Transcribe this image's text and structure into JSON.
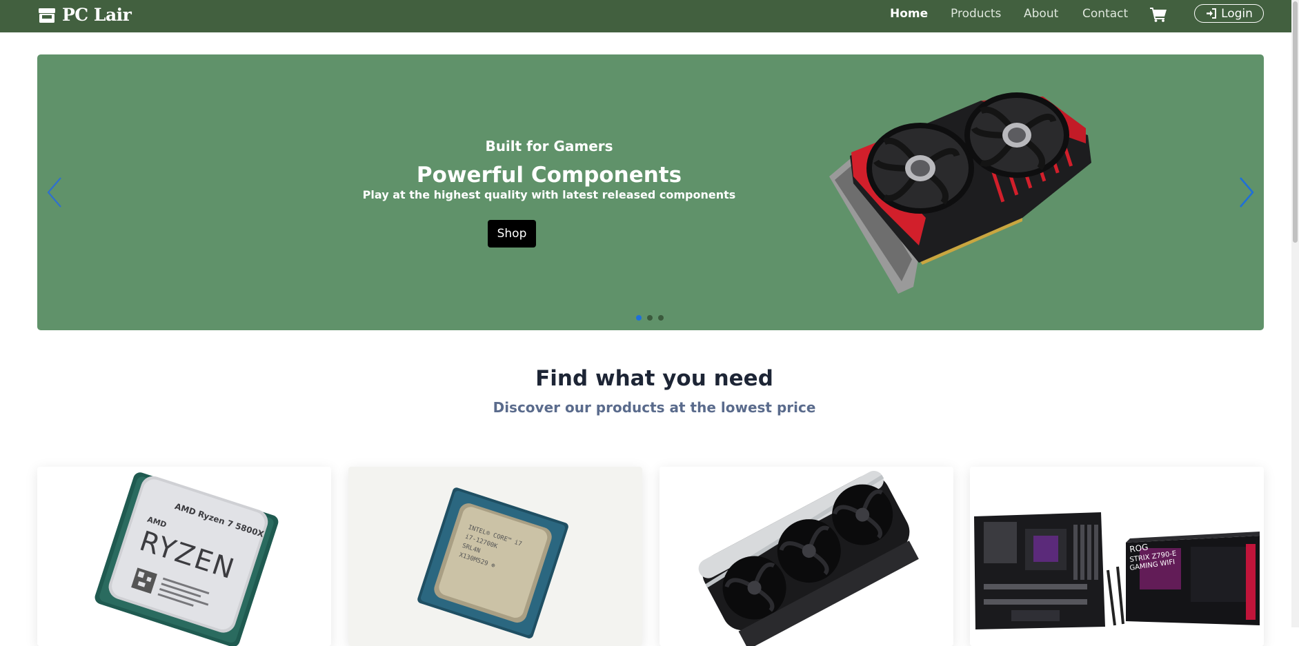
{
  "brand": {
    "name": "PC Lair",
    "icon": "store-icon"
  },
  "nav": {
    "links": [
      {
        "label": "Home",
        "active": true
      },
      {
        "label": "Products",
        "active": false
      },
      {
        "label": "About",
        "active": false
      },
      {
        "label": "Contact",
        "active": false
      }
    ],
    "cart_icon": "shopping-cart-icon",
    "login_label": "Login",
    "login_icon": "sign-in-icon"
  },
  "carousel": {
    "subtitle": "Built for Gamers",
    "title": "Powerful Components",
    "description": "Play at the highest quality with latest released components",
    "button_label": "Shop",
    "slide_count": 3,
    "active_slide": 1,
    "background_color": "#60926a"
  },
  "section": {
    "title": "Find what you need",
    "subtitle": "Discover our products at the lowest price"
  },
  "products": [
    {
      "image": "amd-ryzen-cpu"
    },
    {
      "image": "intel-core-cpu"
    },
    {
      "image": "graphics-card"
    },
    {
      "image": "motherboard-box"
    }
  ],
  "colors": {
    "navbar": "#42603f",
    "accent": "#1e6fd9",
    "heading": "#1d2535",
    "subheading": "#5a6b8c"
  }
}
